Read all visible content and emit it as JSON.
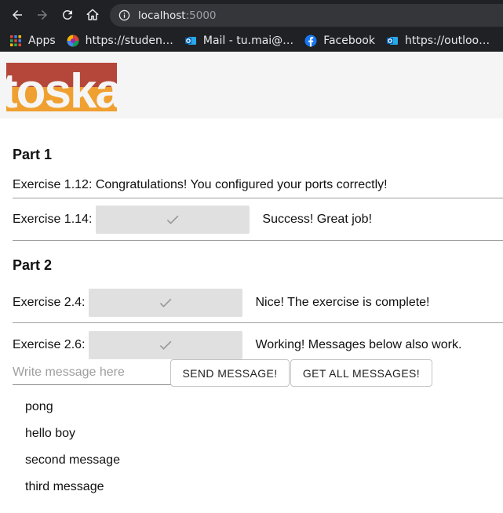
{
  "browser": {
    "url_host": "localhost",
    "url_port": ":5000",
    "bookmarks": [
      {
        "label": "Apps",
        "icon": "apps-grid-icon"
      },
      {
        "label": "https://studen…",
        "icon": "colorful-site-icon"
      },
      {
        "label": "Mail - tu.mai@…",
        "icon": "outlook-icon"
      },
      {
        "label": "Facebook",
        "icon": "facebook-icon"
      },
      {
        "label": "https://outloo…",
        "icon": "outlook-icon"
      }
    ]
  },
  "header": {
    "logo_text": "toska"
  },
  "part1": {
    "title": "Part 1",
    "ex_1_12": "Exercise 1.12: Congratulations! You configured your ports correctly!",
    "ex_1_14_label": "Exercise 1.14:",
    "ex_1_14_status": "Success! Great job!"
  },
  "part2": {
    "title": "Part 2",
    "ex_2_4_label": "Exercise 2.4:",
    "ex_2_4_status": "Nice! The exercise is complete!",
    "ex_2_6_label": "Exercise 2.6:",
    "ex_2_6_status": "Working! Messages below also work.",
    "message_input": {
      "placeholder": "Write message here",
      "value": ""
    },
    "send_button": "SEND MESSAGE!",
    "get_all_button": "GET ALL MESSAGES!",
    "messages": [
      "pong",
      "hello boy",
      "second message",
      "third message"
    ]
  },
  "colors": {
    "logo_red": "#b5473a",
    "logo_orange": "#f0a030",
    "check_button_bg": "#e0e0e0",
    "divider": "#9e9e9e"
  }
}
